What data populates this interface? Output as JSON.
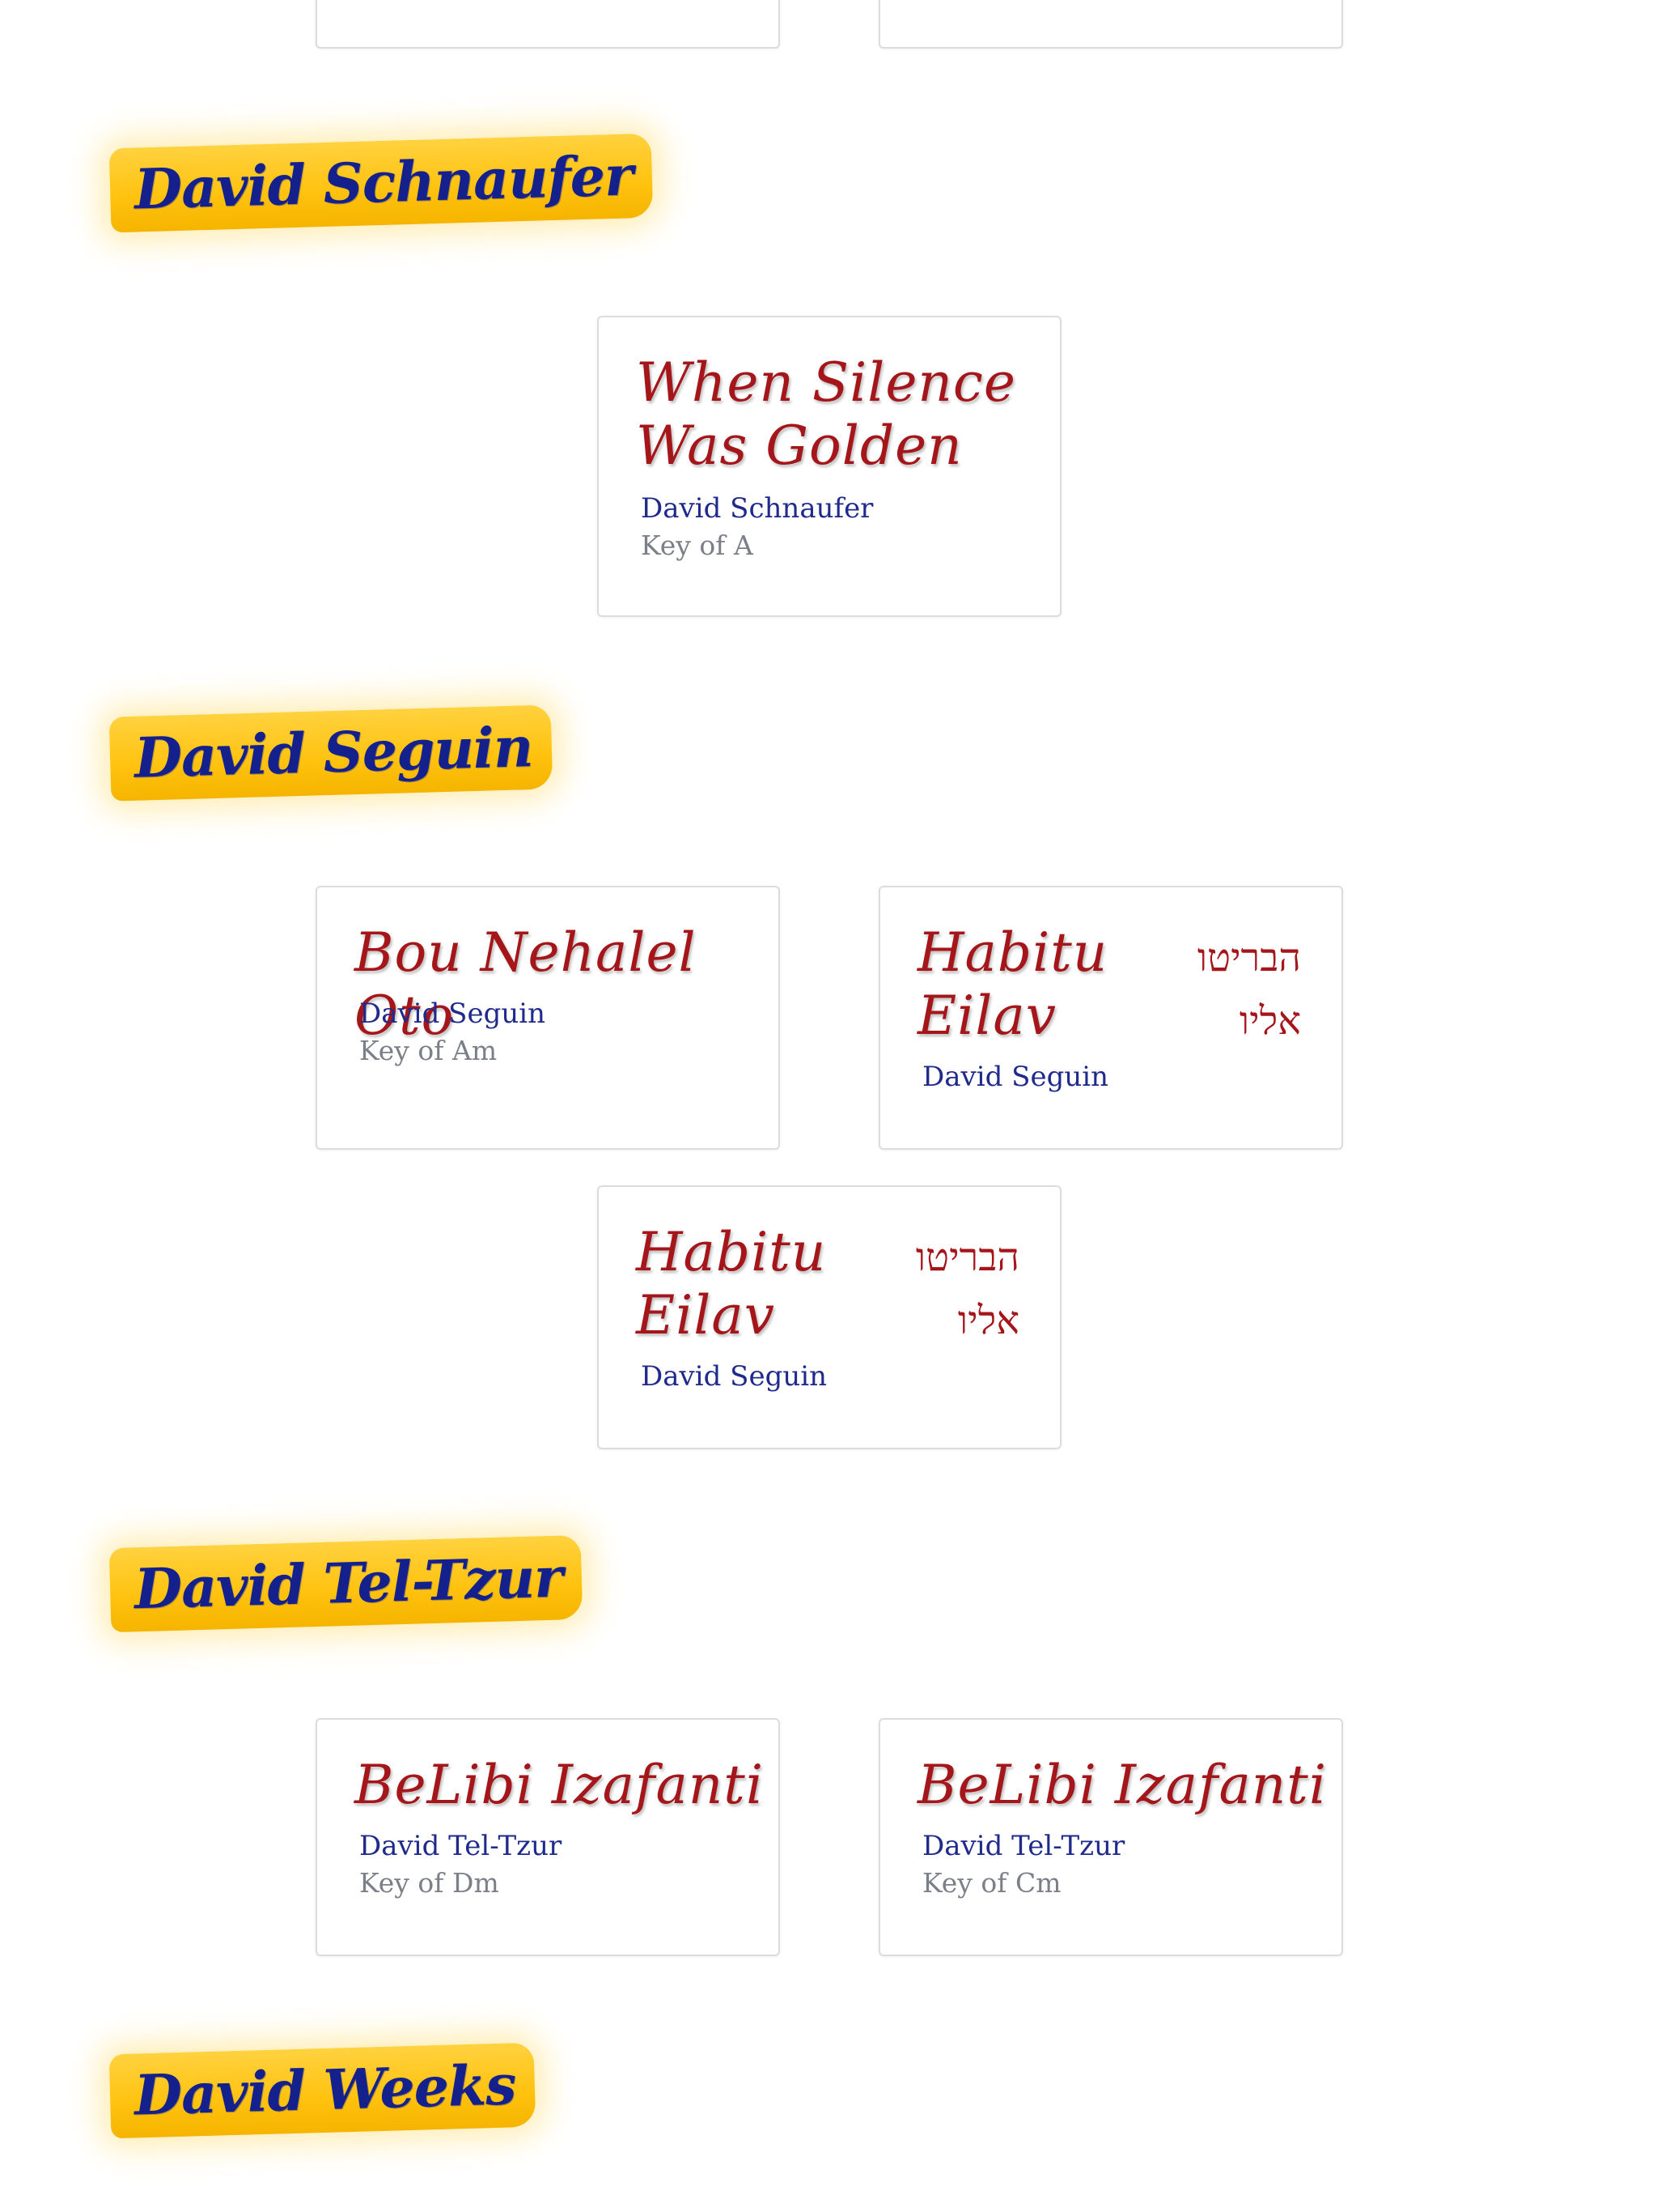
{
  "sections": [
    {
      "artist": "David Schnaufer",
      "songs": [
        {
          "title": "When Silence\nWas Golden",
          "artist": "David Schnaufer",
          "key": "Key of A"
        }
      ]
    },
    {
      "artist": "David Seguin",
      "songs": [
        {
          "title": "Bou Nehalel Oto",
          "artist": "David Seguin",
          "key": "Key of Am"
        },
        {
          "title": "Habitu\nEilav",
          "title_hebrew": "הבריטו\nאליו",
          "artist": "David Seguin"
        },
        {
          "title": "Habitu\nEilav",
          "title_hebrew": "הבריטו\nאליו",
          "artist": "David Seguin"
        }
      ]
    },
    {
      "artist": "David Tel-Tzur",
      "songs": [
        {
          "title": "BeLibi Izafanti",
          "artist": "David Tel-Tzur",
          "key": "Key of Dm"
        },
        {
          "title": "BeLibi Izafanti",
          "artist": "David Tel-Tzur",
          "key": "Key of Cm"
        }
      ]
    },
    {
      "artist": "David Weeks",
      "songs": []
    }
  ],
  "colors": {
    "heading_highlight": "#ffc20e",
    "heading_text": "#14218c",
    "song_title": "#a4161a",
    "artist_text": "#1f2a8c",
    "key_text": "#7b7f87",
    "card_border": "#dcdcdc"
  }
}
